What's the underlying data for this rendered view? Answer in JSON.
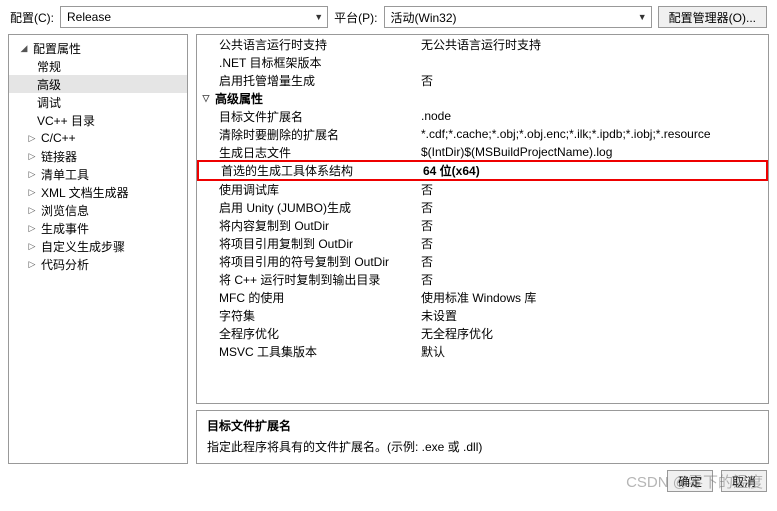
{
  "topbar": {
    "config_label": "配置(C):",
    "config_value": "Release",
    "platform_label": "平台(P):",
    "platform_value": "活动(Win32)",
    "config_manager": "配置管理器(O)..."
  },
  "tree": {
    "root": "配置属性",
    "items": [
      {
        "label": "常规",
        "expandable": false
      },
      {
        "label": "高级",
        "expandable": false,
        "selected": true
      },
      {
        "label": "调试",
        "expandable": false
      },
      {
        "label": "VC++ 目录",
        "expandable": false
      },
      {
        "label": "C/C++",
        "expandable": true
      },
      {
        "label": "链接器",
        "expandable": true
      },
      {
        "label": "清单工具",
        "expandable": true
      },
      {
        "label": "XML 文档生成器",
        "expandable": true
      },
      {
        "label": "浏览信息",
        "expandable": true
      },
      {
        "label": "生成事件",
        "expandable": true
      },
      {
        "label": "自定义生成步骤",
        "expandable": true
      },
      {
        "label": "代码分析",
        "expandable": true
      }
    ]
  },
  "props": {
    "top_rows": [
      {
        "key": "公共语言运行时支持",
        "val": "无公共语言运行时支持"
      },
      {
        "key": ".NET 目标框架版本",
        "val": ""
      },
      {
        "key": "启用托管增量生成",
        "val": "否"
      }
    ],
    "group": "高级属性",
    "rows": [
      {
        "key": "目标文件扩展名",
        "val": ".node"
      },
      {
        "key": "清除时要删除的扩展名",
        "val": "*.cdf;*.cache;*.obj;*.obj.enc;*.ilk;*.ipdb;*.iobj;*.resource"
      },
      {
        "key": "生成日志文件",
        "val": "$(IntDir)$(MSBuildProjectName).log"
      }
    ],
    "highlight": {
      "key": "首选的生成工具体系结构",
      "val": "64 位(x64)"
    },
    "rows2": [
      {
        "key": "使用调试库",
        "val": "否"
      },
      {
        "key": "启用 Unity (JUMBO)生成",
        "val": "否"
      },
      {
        "key": "将内容复制到 OutDir",
        "val": "否"
      },
      {
        "key": "将项目引用复制到 OutDir",
        "val": "否"
      },
      {
        "key": "将项目引用的符号复制到 OutDir",
        "val": "否"
      },
      {
        "key": "将 C++ 运行时复制到输出目录",
        "val": "否"
      },
      {
        "key": "MFC 的使用",
        "val": "使用标准 Windows 库"
      },
      {
        "key": "字符集",
        "val": "未设置"
      },
      {
        "key": "全程序优化",
        "val": "无全程序优化"
      },
      {
        "key": "MSVC 工具集版本",
        "val": "默认"
      }
    ]
  },
  "desc": {
    "title": "目标文件扩展名",
    "text": "指定此程序将具有的文件扩展名。(示例: .exe 或 .dll)"
  },
  "bottom": {
    "ok": "确定",
    "cancel": "取消"
  },
  "watermark": "CSDN @零下的温度"
}
